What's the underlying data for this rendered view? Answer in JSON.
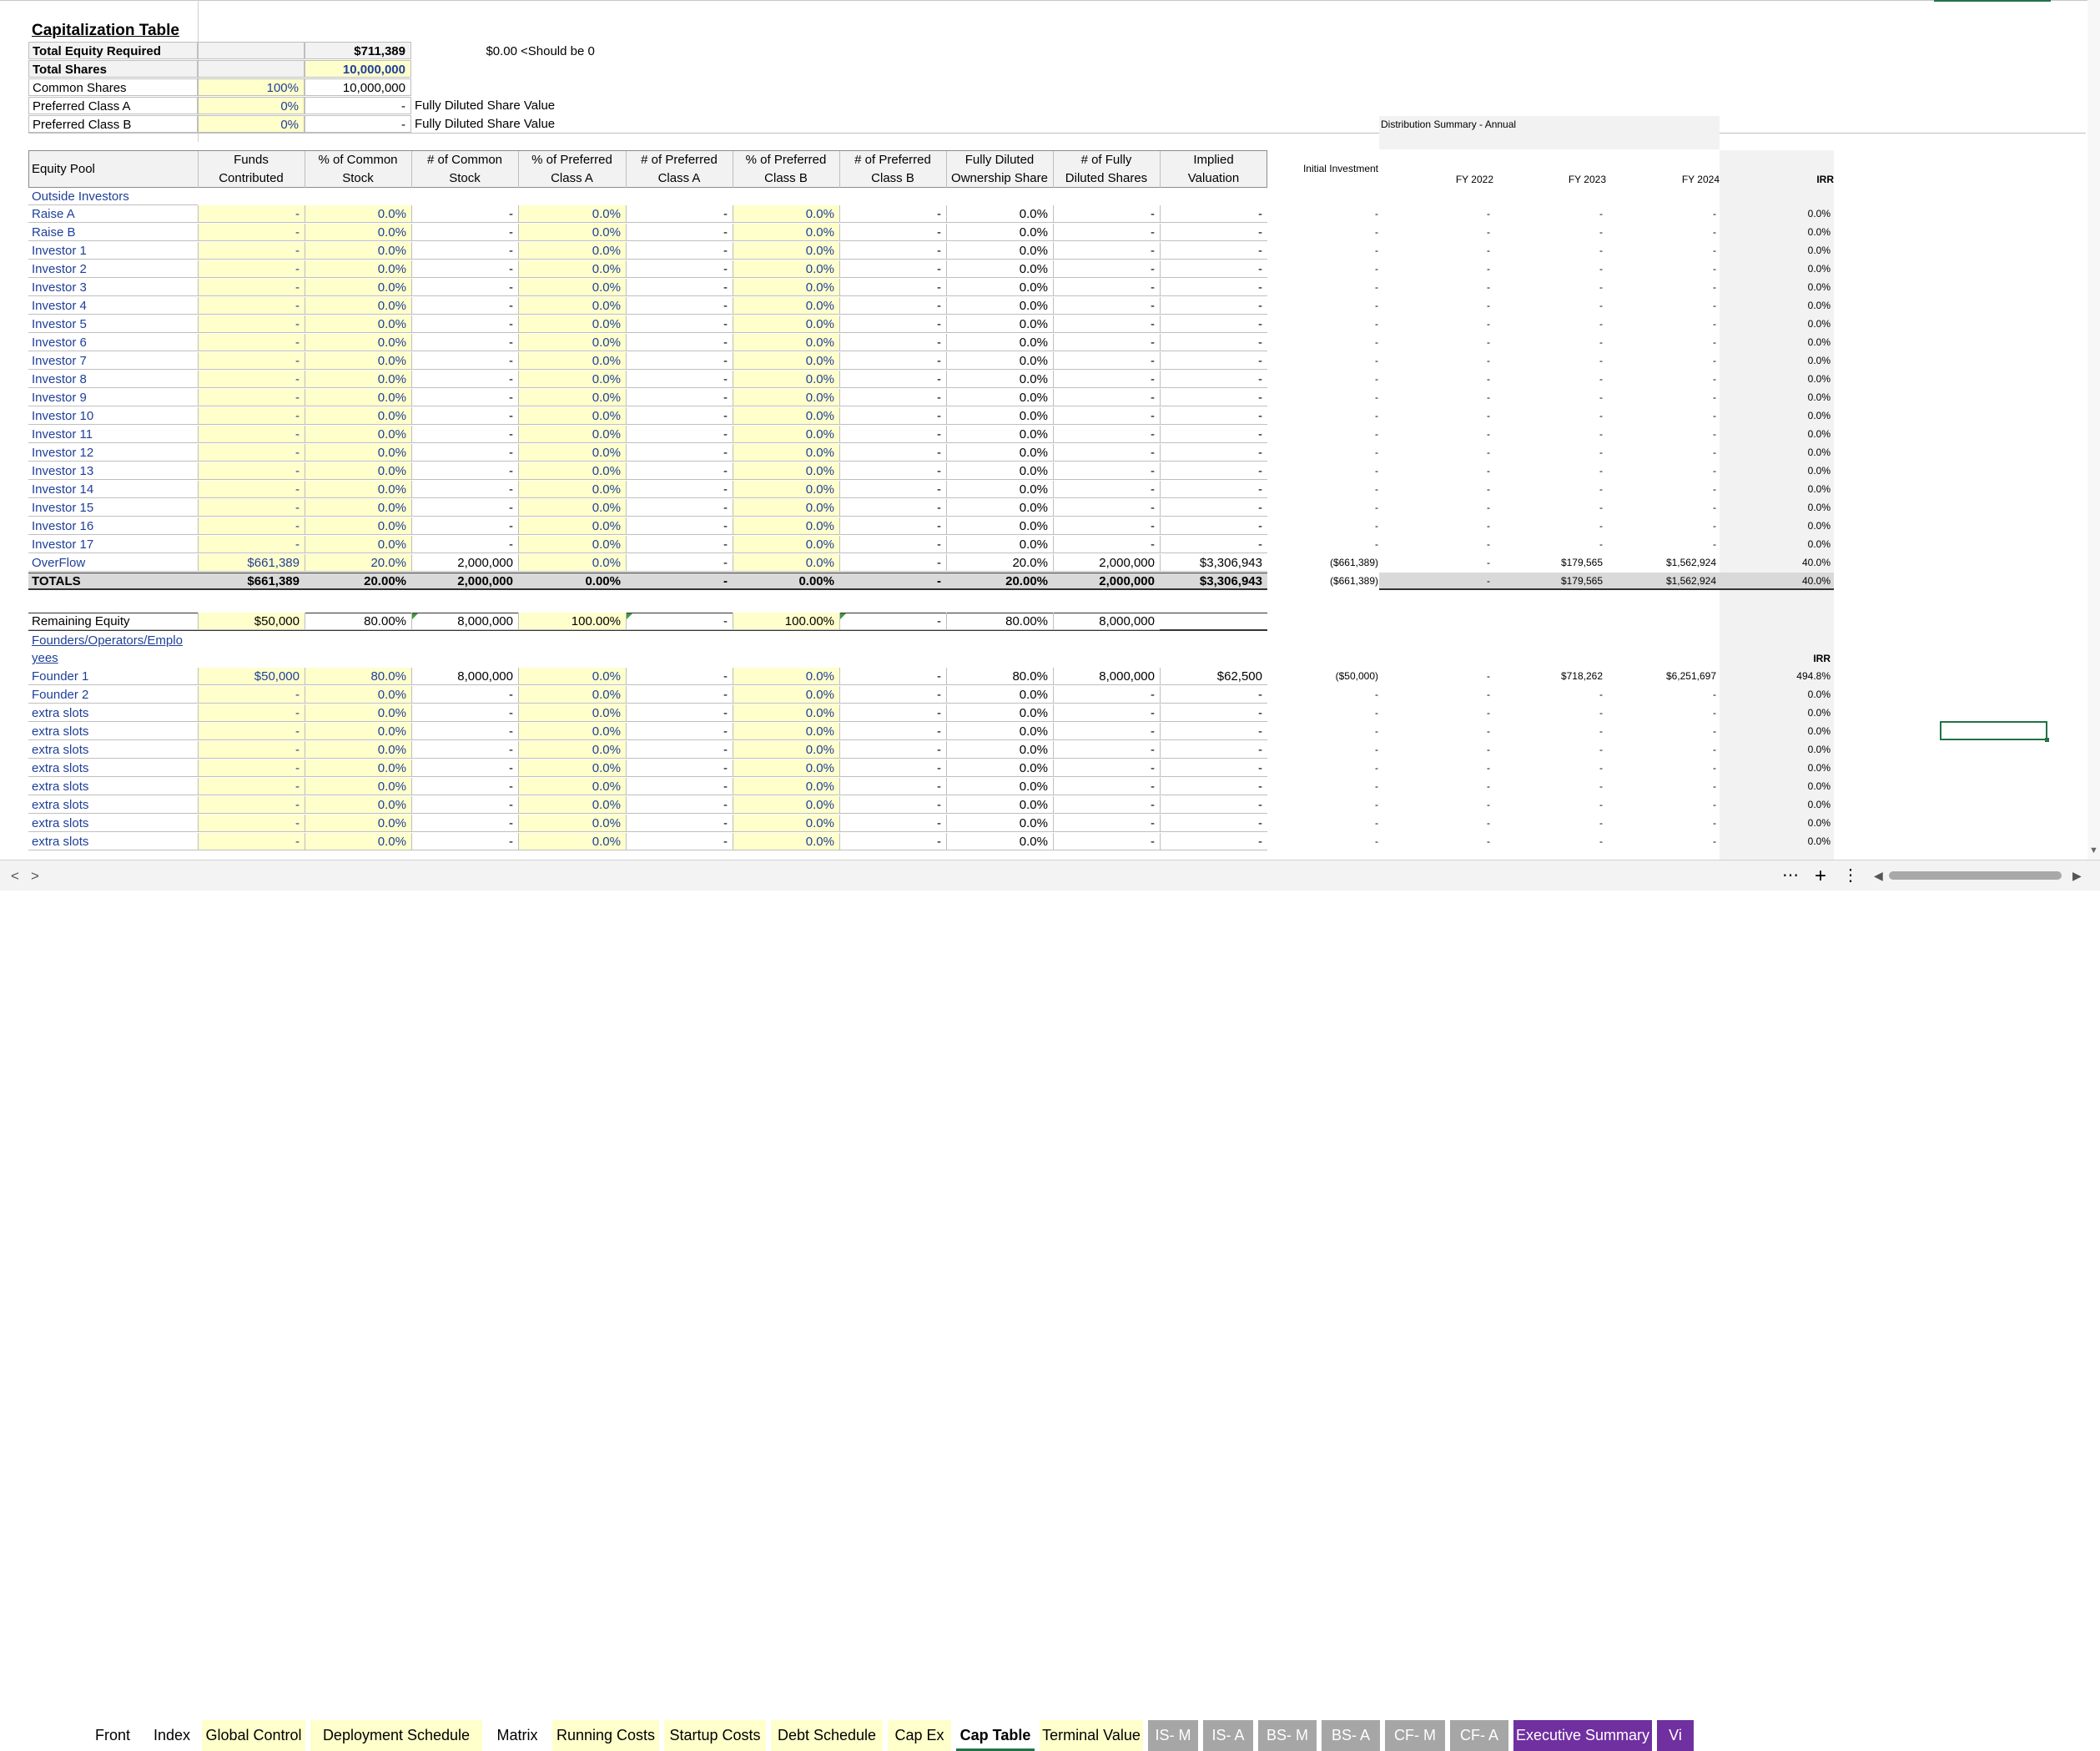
{
  "cap_table": {
    "title": "Capitalization Table",
    "summary": {
      "total_equity_required_label": "Total Equity Required",
      "total_equity_required_value": "$711,389",
      "check_value": "$0.00",
      "check_note": "<Should be 0",
      "total_shares_label": "Total Shares",
      "total_shares_value": "10,000,000",
      "common_shares_label": "Common Shares",
      "common_shares_pct": "100%",
      "common_shares_value": "10,000,000",
      "preferred_a_label": "Preferred Class A",
      "preferred_a_pct": "0%",
      "preferred_a_value": "-",
      "preferred_a_note": "Fully Diluted Share Value",
      "preferred_b_label": "Preferred Class B",
      "preferred_b_pct": "0%",
      "preferred_b_value": "-",
      "preferred_b_note": "Fully Diluted Share Value"
    },
    "headers": {
      "equity_pool": "Equity Pool",
      "funds_1": "Funds",
      "funds_2": "Contributed",
      "pct_common_1": "% of Common",
      "pct_common_2": "Stock",
      "num_common_1": "# of Common",
      "num_common_2": "Stock",
      "pct_pref_a_1": "% of Preferred",
      "pct_pref_a_2": "Class A",
      "num_pref_a_1": "# of Preferred",
      "num_pref_a_2": "Class A",
      "pct_pref_b_1": "% of Preferred",
      "pct_pref_b_2": "Class B",
      "num_pref_b_1": "# of Preferred",
      "num_pref_b_2": "Class B",
      "fd_own_1": "Fully Diluted",
      "fd_own_2": "Ownership Share",
      "num_fd_1": "# of Fully",
      "num_fd_2": "Diluted Shares",
      "implied_1": "Implied",
      "implied_2": "Valuation"
    },
    "outside_investors_label": "Outside Investors",
    "investor_rows": [
      {
        "name": "Raise A",
        "funds": "-",
        "pc": "0.0%",
        "nc": "-",
        "pa": "0.0%",
        "na": "-",
        "pb": "0.0%",
        "nb": "-",
        "fd": "0.0%",
        "nfd": "-",
        "iv": "-",
        "init": "-",
        "fy22": "-",
        "fy23": "-",
        "fy24": "-",
        "irr": "0.0%"
      },
      {
        "name": "Raise B",
        "funds": "-",
        "pc": "0.0%",
        "nc": "-",
        "pa": "0.0%",
        "na": "-",
        "pb": "0.0%",
        "nb": "-",
        "fd": "0.0%",
        "nfd": "-",
        "iv": "-",
        "init": "-",
        "fy22": "-",
        "fy23": "-",
        "fy24": "-",
        "irr": "0.0%"
      },
      {
        "name": "Investor 1",
        "funds": "-",
        "pc": "0.0%",
        "nc": "-",
        "pa": "0.0%",
        "na": "-",
        "pb": "0.0%",
        "nb": "-",
        "fd": "0.0%",
        "nfd": "-",
        "iv": "-",
        "init": "-",
        "fy22": "-",
        "fy23": "-",
        "fy24": "-",
        "irr": "0.0%"
      },
      {
        "name": "Investor 2",
        "funds": "-",
        "pc": "0.0%",
        "nc": "-",
        "pa": "0.0%",
        "na": "-",
        "pb": "0.0%",
        "nb": "-",
        "fd": "0.0%",
        "nfd": "-",
        "iv": "-",
        "init": "-",
        "fy22": "-",
        "fy23": "-",
        "fy24": "-",
        "irr": "0.0%"
      },
      {
        "name": "Investor 3",
        "funds": "-",
        "pc": "0.0%",
        "nc": "-",
        "pa": "0.0%",
        "na": "-",
        "pb": "0.0%",
        "nb": "-",
        "fd": "0.0%",
        "nfd": "-",
        "iv": "-",
        "init": "-",
        "fy22": "-",
        "fy23": "-",
        "fy24": "-",
        "irr": "0.0%"
      },
      {
        "name": "Investor 4",
        "funds": "-",
        "pc": "0.0%",
        "nc": "-",
        "pa": "0.0%",
        "na": "-",
        "pb": "0.0%",
        "nb": "-",
        "fd": "0.0%",
        "nfd": "-",
        "iv": "-",
        "init": "-",
        "fy22": "-",
        "fy23": "-",
        "fy24": "-",
        "irr": "0.0%"
      },
      {
        "name": "Investor 5",
        "funds": "-",
        "pc": "0.0%",
        "nc": "-",
        "pa": "0.0%",
        "na": "-",
        "pb": "0.0%",
        "nb": "-",
        "fd": "0.0%",
        "nfd": "-",
        "iv": "-",
        "init": "-",
        "fy22": "-",
        "fy23": "-",
        "fy24": "-",
        "irr": "0.0%"
      },
      {
        "name": "Investor 6",
        "funds": "-",
        "pc": "0.0%",
        "nc": "-",
        "pa": "0.0%",
        "na": "-",
        "pb": "0.0%",
        "nb": "-",
        "fd": "0.0%",
        "nfd": "-",
        "iv": "-",
        "init": "-",
        "fy22": "-",
        "fy23": "-",
        "fy24": "-",
        "irr": "0.0%"
      },
      {
        "name": "Investor 7",
        "funds": "-",
        "pc": "0.0%",
        "nc": "-",
        "pa": "0.0%",
        "na": "-",
        "pb": "0.0%",
        "nb": "-",
        "fd": "0.0%",
        "nfd": "-",
        "iv": "-",
        "init": "-",
        "fy22": "-",
        "fy23": "-",
        "fy24": "-",
        "irr": "0.0%"
      },
      {
        "name": "Investor 8",
        "funds": "-",
        "pc": "0.0%",
        "nc": "-",
        "pa": "0.0%",
        "na": "-",
        "pb": "0.0%",
        "nb": "-",
        "fd": "0.0%",
        "nfd": "-",
        "iv": "-",
        "init": "-",
        "fy22": "-",
        "fy23": "-",
        "fy24": "-",
        "irr": "0.0%"
      },
      {
        "name": "Investor 9",
        "funds": "-",
        "pc": "0.0%",
        "nc": "-",
        "pa": "0.0%",
        "na": "-",
        "pb": "0.0%",
        "nb": "-",
        "fd": "0.0%",
        "nfd": "-",
        "iv": "-",
        "init": "-",
        "fy22": "-",
        "fy23": "-",
        "fy24": "-",
        "irr": "0.0%"
      },
      {
        "name": "Investor 10",
        "funds": "-",
        "pc": "0.0%",
        "nc": "-",
        "pa": "0.0%",
        "na": "-",
        "pb": "0.0%",
        "nb": "-",
        "fd": "0.0%",
        "nfd": "-",
        "iv": "-",
        "init": "-",
        "fy22": "-",
        "fy23": "-",
        "fy24": "-",
        "irr": "0.0%"
      },
      {
        "name": "Investor 11",
        "funds": "-",
        "pc": "0.0%",
        "nc": "-",
        "pa": "0.0%",
        "na": "-",
        "pb": "0.0%",
        "nb": "-",
        "fd": "0.0%",
        "nfd": "-",
        "iv": "-",
        "init": "-",
        "fy22": "-",
        "fy23": "-",
        "fy24": "-",
        "irr": "0.0%"
      },
      {
        "name": "Investor 12",
        "funds": "-",
        "pc": "0.0%",
        "nc": "-",
        "pa": "0.0%",
        "na": "-",
        "pb": "0.0%",
        "nb": "-",
        "fd": "0.0%",
        "nfd": "-",
        "iv": "-",
        "init": "-",
        "fy22": "-",
        "fy23": "-",
        "fy24": "-",
        "irr": "0.0%"
      },
      {
        "name": "Investor 13",
        "funds": "-",
        "pc": "0.0%",
        "nc": "-",
        "pa": "0.0%",
        "na": "-",
        "pb": "0.0%",
        "nb": "-",
        "fd": "0.0%",
        "nfd": "-",
        "iv": "-",
        "init": "-",
        "fy22": "-",
        "fy23": "-",
        "fy24": "-",
        "irr": "0.0%"
      },
      {
        "name": "Investor 14",
        "funds": "-",
        "pc": "0.0%",
        "nc": "-",
        "pa": "0.0%",
        "na": "-",
        "pb": "0.0%",
        "nb": "-",
        "fd": "0.0%",
        "nfd": "-",
        "iv": "-",
        "init": "-",
        "fy22": "-",
        "fy23": "-",
        "fy24": "-",
        "irr": "0.0%"
      },
      {
        "name": "Investor 15",
        "funds": "-",
        "pc": "0.0%",
        "nc": "-",
        "pa": "0.0%",
        "na": "-",
        "pb": "0.0%",
        "nb": "-",
        "fd": "0.0%",
        "nfd": "-",
        "iv": "-",
        "init": "-",
        "fy22": "-",
        "fy23": "-",
        "fy24": "-",
        "irr": "0.0%"
      },
      {
        "name": "Investor 16",
        "funds": "-",
        "pc": "0.0%",
        "nc": "-",
        "pa": "0.0%",
        "na": "-",
        "pb": "0.0%",
        "nb": "-",
        "fd": "0.0%",
        "nfd": "-",
        "iv": "-",
        "init": "-",
        "fy22": "-",
        "fy23": "-",
        "fy24": "-",
        "irr": "0.0%"
      },
      {
        "name": "Investor 17",
        "funds": "-",
        "pc": "0.0%",
        "nc": "-",
        "pa": "0.0%",
        "na": "-",
        "pb": "0.0%",
        "nb": "-",
        "fd": "0.0%",
        "nfd": "-",
        "iv": "-",
        "init": "-",
        "fy22": "-",
        "fy23": "-",
        "fy24": "-",
        "irr": "0.0%"
      },
      {
        "name": "OverFlow",
        "funds": "$661,389",
        "pc": "20.0%",
        "nc": "2,000,000",
        "pa": "0.0%",
        "na": "-",
        "pb": "0.0%",
        "nb": "-",
        "fd": "20.0%",
        "nfd": "2,000,000",
        "iv": "$3,306,943",
        "init": "($661,389)",
        "fy22": "-",
        "fy23": "$179,565",
        "fy24": "$1,562,924",
        "irr": "40.0%"
      }
    ],
    "totals": {
      "name": "TOTALS",
      "funds": "$661,389",
      "pc": "20.00%",
      "nc": "2,000,000",
      "pa": "0.00%",
      "na": "-",
      "pb": "0.00%",
      "nb": "-",
      "fd": "20.00%",
      "nfd": "2,000,000",
      "iv": "$3,306,943",
      "init": "($661,389)",
      "fy22": "-",
      "fy23": "$179,565",
      "fy24": "$1,562,924",
      "irr": "40.0%"
    },
    "remaining": {
      "name": "Remaining Equity",
      "funds": "$50,000",
      "pc": "80.00%",
      "nc": "8,000,000",
      "pa": "100.00%",
      "na": "-",
      "pb": "100.00%",
      "nb": "-",
      "fd": "80.00%",
      "nfd": "8,000,000"
    },
    "founders_label_1": "Founders/Operators/Emplo",
    "founders_label_2": "yees",
    "founders_irr_header": "IRR",
    "founder_rows": [
      {
        "name": "Founder 1",
        "funds": "$50,000",
        "pc": "80.0%",
        "nc": "8,000,000",
        "pa": "0.0%",
        "na": "-",
        "pb": "0.0%",
        "nb": "-",
        "fd": "80.0%",
        "nfd": "8,000,000",
        "iv": "$62,500",
        "init": "($50,000)",
        "fy22": "-",
        "fy23": "$718,262",
        "fy24": "$6,251,697",
        "irr": "494.8%"
      },
      {
        "name": "Founder 2",
        "funds": "-",
        "pc": "0.0%",
        "nc": "-",
        "pa": "0.0%",
        "na": "-",
        "pb": "0.0%",
        "nb": "-",
        "fd": "0.0%",
        "nfd": "-",
        "iv": "-",
        "init": "-",
        "fy22": "-",
        "fy23": "-",
        "fy24": "-",
        "irr": "0.0%"
      },
      {
        "name": "extra slots",
        "funds": "-",
        "pc": "0.0%",
        "nc": "-",
        "pa": "0.0%",
        "na": "-",
        "pb": "0.0%",
        "nb": "-",
        "fd": "0.0%",
        "nfd": "-",
        "iv": "-",
        "init": "-",
        "fy22": "-",
        "fy23": "-",
        "fy24": "-",
        "irr": "0.0%"
      },
      {
        "name": "extra slots",
        "funds": "-",
        "pc": "0.0%",
        "nc": "-",
        "pa": "0.0%",
        "na": "-",
        "pb": "0.0%",
        "nb": "-",
        "fd": "0.0%",
        "nfd": "-",
        "iv": "-",
        "init": "-",
        "fy22": "-",
        "fy23": "-",
        "fy24": "-",
        "irr": "0.0%"
      },
      {
        "name": "extra slots",
        "funds": "-",
        "pc": "0.0%",
        "nc": "-",
        "pa": "0.0%",
        "na": "-",
        "pb": "0.0%",
        "nb": "-",
        "fd": "0.0%",
        "nfd": "-",
        "iv": "-",
        "init": "-",
        "fy22": "-",
        "fy23": "-",
        "fy24": "-",
        "irr": "0.0%"
      },
      {
        "name": "extra slots",
        "funds": "-",
        "pc": "0.0%",
        "nc": "-",
        "pa": "0.0%",
        "na": "-",
        "pb": "0.0%",
        "nb": "-",
        "fd": "0.0%",
        "nfd": "-",
        "iv": "-",
        "init": "-",
        "fy22": "-",
        "fy23": "-",
        "fy24": "-",
        "irr": "0.0%"
      },
      {
        "name": "extra slots",
        "funds": "-",
        "pc": "0.0%",
        "nc": "-",
        "pa": "0.0%",
        "na": "-",
        "pb": "0.0%",
        "nb": "-",
        "fd": "0.0%",
        "nfd": "-",
        "iv": "-",
        "init": "-",
        "fy22": "-",
        "fy23": "-",
        "fy24": "-",
        "irr": "0.0%"
      },
      {
        "name": "extra slots",
        "funds": "-",
        "pc": "0.0%",
        "nc": "-",
        "pa": "0.0%",
        "na": "-",
        "pb": "0.0%",
        "nb": "-",
        "fd": "0.0%",
        "nfd": "-",
        "iv": "-",
        "init": "-",
        "fy22": "-",
        "fy23": "-",
        "fy24": "-",
        "irr": "0.0%"
      },
      {
        "name": "extra slots",
        "funds": "-",
        "pc": "0.0%",
        "nc": "-",
        "pa": "0.0%",
        "na": "-",
        "pb": "0.0%",
        "nb": "-",
        "fd": "0.0%",
        "nfd": "-",
        "iv": "-",
        "init": "-",
        "fy22": "-",
        "fy23": "-",
        "fy24": "-",
        "irr": "0.0%"
      },
      {
        "name": "extra slots",
        "funds": "-",
        "pc": "0.0%",
        "nc": "-",
        "pa": "0.0%",
        "na": "-",
        "pb": "0.0%",
        "nb": "-",
        "fd": "0.0%",
        "nfd": "-",
        "iv": "-",
        "init": "-",
        "fy22": "-",
        "fy23": "-",
        "fy24": "-",
        "irr": "0.0%"
      }
    ]
  },
  "distribution": {
    "title": "Distribution Summary - Annual",
    "initial_investment": "Initial Investment",
    "fy2022": "FY 2022",
    "fy2023": "FY 2023",
    "fy2024": "FY 2024",
    "irr": "IRR"
  },
  "sheet_tabs": {
    "nav_prev": "<",
    "nav_next": ">",
    "tabs": [
      {
        "label": "Front",
        "bg": "#ffffff",
        "fg": "#000000"
      },
      {
        "label": "Index",
        "bg": "#ffffff",
        "fg": "#000000"
      },
      {
        "label": "Global Control",
        "bg": "#ffffcc",
        "fg": "#000000"
      },
      {
        "label": "Deployment Schedule",
        "bg": "#ffffcc",
        "fg": "#000000"
      },
      {
        "label": "Matrix",
        "bg": "#ffffff",
        "fg": "#000000"
      },
      {
        "label": "Running Costs",
        "bg": "#ffffcc",
        "fg": "#000000"
      },
      {
        "label": "Startup Costs",
        "bg": "#ffffcc",
        "fg": "#000000"
      },
      {
        "label": "Debt Schedule",
        "bg": "#ffffcc",
        "fg": "#000000"
      },
      {
        "label": "Cap Ex",
        "bg": "#ffffcc",
        "fg": "#000000"
      },
      {
        "label": "Cap Table",
        "bg": "#ffffff",
        "fg": "#000000"
      },
      {
        "label": "Terminal Value",
        "bg": "#ffffcc",
        "fg": "#000000"
      },
      {
        "label": "IS- M",
        "bg": "#a6a6a6",
        "fg": "#ffffff"
      },
      {
        "label": "IS- A",
        "bg": "#a6a6a6",
        "fg": "#ffffff"
      },
      {
        "label": "BS- M",
        "bg": "#a6a6a6",
        "fg": "#ffffff"
      },
      {
        "label": "BS- A",
        "bg": "#a6a6a6",
        "fg": "#ffffff"
      },
      {
        "label": "CF- M",
        "bg": "#a6a6a6",
        "fg": "#ffffff"
      },
      {
        "label": "CF- A",
        "bg": "#a6a6a6",
        "fg": "#ffffff"
      },
      {
        "label": "Executive Summary",
        "bg": "#7030a0",
        "fg": "#ffffff"
      },
      {
        "label": "Vi",
        "bg": "#7030a0",
        "fg": "#ffffff"
      }
    ],
    "active": "Cap Table",
    "more": "⋯",
    "add": "+",
    "options": "⋮"
  },
  "colors": {
    "input_yellow": "#ffffcc",
    "header_gray": "#f2f2f2",
    "blue_text": "#1f3f99",
    "active_tab_underline": "#217346"
  }
}
